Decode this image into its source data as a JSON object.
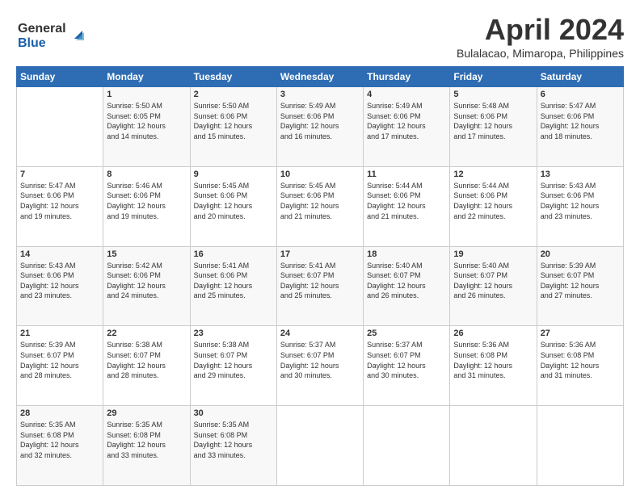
{
  "logo": {
    "line1": "General",
    "line2": "Blue"
  },
  "title": "April 2024",
  "location": "Bulalacao, Mimaropa, Philippines",
  "days_header": [
    "Sunday",
    "Monday",
    "Tuesday",
    "Wednesday",
    "Thursday",
    "Friday",
    "Saturday"
  ],
  "weeks": [
    [
      {
        "day": "",
        "info": ""
      },
      {
        "day": "1",
        "info": "Sunrise: 5:50 AM\nSunset: 6:05 PM\nDaylight: 12 hours\nand 14 minutes."
      },
      {
        "day": "2",
        "info": "Sunrise: 5:50 AM\nSunset: 6:06 PM\nDaylight: 12 hours\nand 15 minutes."
      },
      {
        "day": "3",
        "info": "Sunrise: 5:49 AM\nSunset: 6:06 PM\nDaylight: 12 hours\nand 16 minutes."
      },
      {
        "day": "4",
        "info": "Sunrise: 5:49 AM\nSunset: 6:06 PM\nDaylight: 12 hours\nand 17 minutes."
      },
      {
        "day": "5",
        "info": "Sunrise: 5:48 AM\nSunset: 6:06 PM\nDaylight: 12 hours\nand 17 minutes."
      },
      {
        "day": "6",
        "info": "Sunrise: 5:47 AM\nSunset: 6:06 PM\nDaylight: 12 hours\nand 18 minutes."
      }
    ],
    [
      {
        "day": "7",
        "info": "Sunrise: 5:47 AM\nSunset: 6:06 PM\nDaylight: 12 hours\nand 19 minutes."
      },
      {
        "day": "8",
        "info": "Sunrise: 5:46 AM\nSunset: 6:06 PM\nDaylight: 12 hours\nand 19 minutes."
      },
      {
        "day": "9",
        "info": "Sunrise: 5:45 AM\nSunset: 6:06 PM\nDaylight: 12 hours\nand 20 minutes."
      },
      {
        "day": "10",
        "info": "Sunrise: 5:45 AM\nSunset: 6:06 PM\nDaylight: 12 hours\nand 21 minutes."
      },
      {
        "day": "11",
        "info": "Sunrise: 5:44 AM\nSunset: 6:06 PM\nDaylight: 12 hours\nand 21 minutes."
      },
      {
        "day": "12",
        "info": "Sunrise: 5:44 AM\nSunset: 6:06 PM\nDaylight: 12 hours\nand 22 minutes."
      },
      {
        "day": "13",
        "info": "Sunrise: 5:43 AM\nSunset: 6:06 PM\nDaylight: 12 hours\nand 23 minutes."
      }
    ],
    [
      {
        "day": "14",
        "info": "Sunrise: 5:43 AM\nSunset: 6:06 PM\nDaylight: 12 hours\nand 23 minutes."
      },
      {
        "day": "15",
        "info": "Sunrise: 5:42 AM\nSunset: 6:06 PM\nDaylight: 12 hours\nand 24 minutes."
      },
      {
        "day": "16",
        "info": "Sunrise: 5:41 AM\nSunset: 6:06 PM\nDaylight: 12 hours\nand 25 minutes."
      },
      {
        "day": "17",
        "info": "Sunrise: 5:41 AM\nSunset: 6:07 PM\nDaylight: 12 hours\nand 25 minutes."
      },
      {
        "day": "18",
        "info": "Sunrise: 5:40 AM\nSunset: 6:07 PM\nDaylight: 12 hours\nand 26 minutes."
      },
      {
        "day": "19",
        "info": "Sunrise: 5:40 AM\nSunset: 6:07 PM\nDaylight: 12 hours\nand 26 minutes."
      },
      {
        "day": "20",
        "info": "Sunrise: 5:39 AM\nSunset: 6:07 PM\nDaylight: 12 hours\nand 27 minutes."
      }
    ],
    [
      {
        "day": "21",
        "info": "Sunrise: 5:39 AM\nSunset: 6:07 PM\nDaylight: 12 hours\nand 28 minutes."
      },
      {
        "day": "22",
        "info": "Sunrise: 5:38 AM\nSunset: 6:07 PM\nDaylight: 12 hours\nand 28 minutes."
      },
      {
        "day": "23",
        "info": "Sunrise: 5:38 AM\nSunset: 6:07 PM\nDaylight: 12 hours\nand 29 minutes."
      },
      {
        "day": "24",
        "info": "Sunrise: 5:37 AM\nSunset: 6:07 PM\nDaylight: 12 hours\nand 30 minutes."
      },
      {
        "day": "25",
        "info": "Sunrise: 5:37 AM\nSunset: 6:07 PM\nDaylight: 12 hours\nand 30 minutes."
      },
      {
        "day": "26",
        "info": "Sunrise: 5:36 AM\nSunset: 6:08 PM\nDaylight: 12 hours\nand 31 minutes."
      },
      {
        "day": "27",
        "info": "Sunrise: 5:36 AM\nSunset: 6:08 PM\nDaylight: 12 hours\nand 31 minutes."
      }
    ],
    [
      {
        "day": "28",
        "info": "Sunrise: 5:35 AM\nSunset: 6:08 PM\nDaylight: 12 hours\nand 32 minutes."
      },
      {
        "day": "29",
        "info": "Sunrise: 5:35 AM\nSunset: 6:08 PM\nDaylight: 12 hours\nand 33 minutes."
      },
      {
        "day": "30",
        "info": "Sunrise: 5:35 AM\nSunset: 6:08 PM\nDaylight: 12 hours\nand 33 minutes."
      },
      {
        "day": "",
        "info": ""
      },
      {
        "day": "",
        "info": ""
      },
      {
        "day": "",
        "info": ""
      },
      {
        "day": "",
        "info": ""
      }
    ]
  ]
}
